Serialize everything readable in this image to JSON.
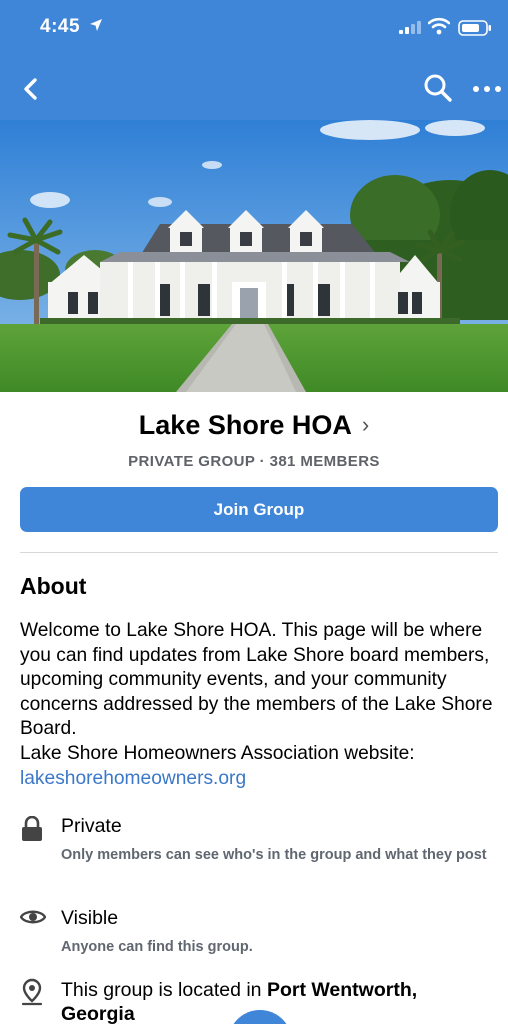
{
  "status": {
    "time": "4:45"
  },
  "colors": {
    "primary": "#3f86d9",
    "link": "#3b78c7",
    "secondary_text": "#606770"
  },
  "nav": {
    "icons": [
      "back-chevron-icon",
      "search-icon",
      "more-icon"
    ]
  },
  "group": {
    "name": "Lake Shore HOA",
    "meta": "PRIVATE GROUP · 381 MEMBERS",
    "join_label": "Join Group"
  },
  "about": {
    "heading": "About",
    "description": "Welcome to Lake Shore HOA.  This page will be where you can find updates from Lake Shore board members, upcoming community events, and your community concerns addressed by the members of the Lake Shore Board.",
    "website_line": "Lake Shore Homeowners Association website:",
    "website_link": "lakeshorehomeowners.org"
  },
  "info": {
    "private": {
      "title": "Private",
      "subtitle": "Only members can see who's in the group and what they post",
      "icon": "lock-icon"
    },
    "visible": {
      "title": "Visible",
      "subtitle": "Anyone can find this group.",
      "icon": "eye-icon"
    },
    "location": {
      "prefix": "This group is located in ",
      "place": "Port Wentworth, Georgia",
      "icon": "location-pin-icon"
    }
  }
}
